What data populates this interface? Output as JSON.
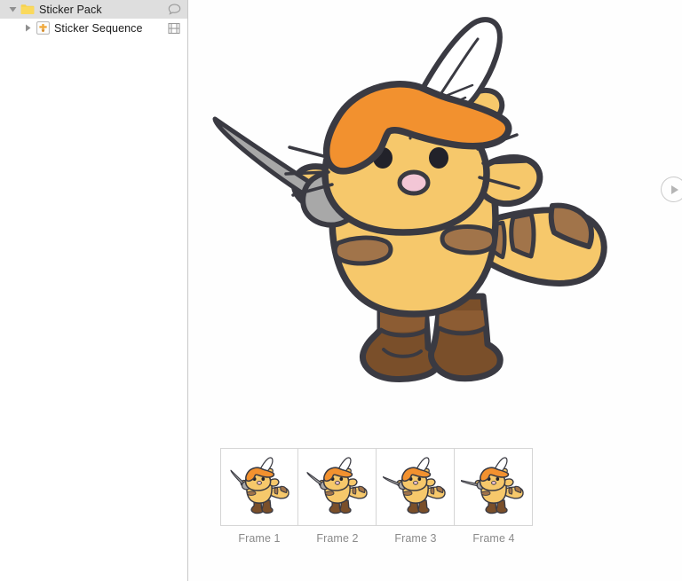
{
  "window": {
    "title": "Sticker Pack"
  },
  "sidebar": {
    "rows": [
      {
        "label": "Sticker Pack",
        "twisty": "disclosure-triangle-open",
        "icon": "folder-icon",
        "trailing_icon": "comment-bubble-icon",
        "selected": true,
        "level": 0
      },
      {
        "label": "Sticker Sequence",
        "twisty": "disclosure-triangle-closed",
        "icon": "sticker-sequence-icon",
        "trailing_icon": "film-strip-icon",
        "selected": false,
        "level": 1
      }
    ]
  },
  "canvas": {
    "preview_name": "sticker-sequence-preview",
    "subject": "cat-musketeer-with-sword-and-feathered-hat",
    "play_overlay": "play-button-overlay",
    "colors": {
      "outline": "#3a3a42",
      "body": "#f6c86b",
      "stripe": "#a1744a",
      "hat": "#f2912f",
      "boot": "#7a4f2a",
      "boot_dark": "#6b4423",
      "blade": "#a8a8a8",
      "feather": "#ffffff",
      "nose": "#f3c6d6",
      "eye": "#22222a"
    }
  },
  "filmstrip": {
    "frames": [
      {
        "label": "Frame 1",
        "sword_angle": -24
      },
      {
        "label": "Frame 2",
        "sword_angle": -31
      },
      {
        "label": "Frame 3",
        "sword_angle": -42
      },
      {
        "label": "Frame 4",
        "sword_angle": -50
      }
    ]
  }
}
